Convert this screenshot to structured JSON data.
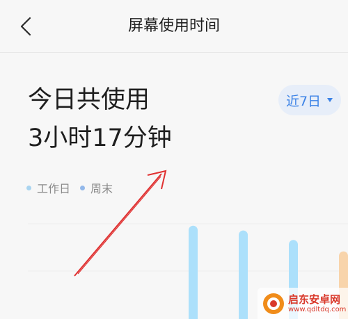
{
  "header": {
    "title": "屏幕使用时间",
    "back_icon": "chevron-left-icon"
  },
  "summary": {
    "label": "今日共使用",
    "value": "3小时17分钟"
  },
  "range_select": {
    "selected": "近7日",
    "icon": "caret-down-icon",
    "accent": "#3b82e6",
    "background": "#e7eef9"
  },
  "legend": {
    "items": [
      {
        "label": "工作日",
        "color": "#a9d4f0"
      },
      {
        "label": "周末",
        "color": "#93b8ea"
      }
    ]
  },
  "chart_data": {
    "type": "bar",
    "bars": [
      {
        "value": 0,
        "color": "#ace0fb"
      },
      {
        "value": 0,
        "color": "#ace0fb"
      },
      {
        "value": 0,
        "color": "#ace0fb"
      },
      {
        "value": 0.98,
        "color": "#ace0fb"
      },
      {
        "value": 0.93,
        "color": "#ace0fb"
      },
      {
        "value": 0.83,
        "color": "#ace0fb"
      },
      {
        "value": 0.71,
        "color": "#f8d4ab"
      }
    ],
    "ylim": [
      0,
      1
    ]
  },
  "annotation": {
    "color": "#e03131"
  },
  "watermark": {
    "name": "启东安卓网",
    "url": "www.qdltdq.com",
    "icon": "logo-icon"
  }
}
